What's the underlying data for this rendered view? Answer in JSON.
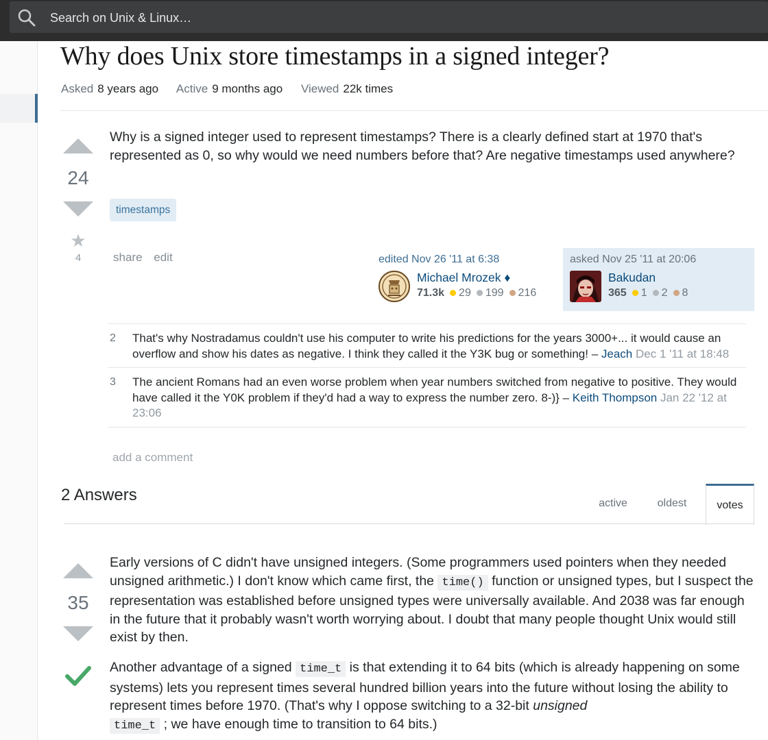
{
  "search": {
    "placeholder": "Search on Unix & Linux…"
  },
  "question": {
    "title": "Why does Unix store timestamps in a signed integer?",
    "meta": [
      {
        "label": "Asked",
        "value": "8 years ago"
      },
      {
        "label": "Active",
        "value": "9 months ago"
      },
      {
        "label": "Viewed",
        "value": "22k times"
      }
    ],
    "votes": "24",
    "favorites": "4",
    "body": "Why is a signed integer used to represent timestamps? There is a clearly defined start at 1970 that's represented as 0, so why would we need numbers before that? Are negative timestamps used anywhere?",
    "tags": [
      "timestamps"
    ],
    "menu": {
      "share": "share",
      "edit": "edit"
    },
    "editor": {
      "action": "edited Nov 26 '11 at 6:38",
      "name": "Michael Mrozek ♦",
      "rep": "71.3k",
      "gold": "29",
      "silver": "199",
      "bronze": "216"
    },
    "owner": {
      "action": "asked Nov 25 '11 at 20:06",
      "name": "Bakudan",
      "rep": "365",
      "gold": "1",
      "silver": "2",
      "bronze": "8"
    },
    "comments": [
      {
        "score": "2",
        "text": "That's why Nostradamus couldn't use his computer to write his predictions for the years 3000+... it would cause an overflow and show his dates as negative. I think they called it the Y3K bug or something!",
        "sep": " – ",
        "user": "Jeach",
        "date": "Dec 1 '11 at 18:48"
      },
      {
        "score": "3",
        "text": "The ancient Romans had an even worse problem when year numbers switched from negative to positive. They would have called it the Y0K problem if they'd had a way to express the number zero. 8-)}",
        "sep": " – ",
        "user": "Keith Thompson",
        "date": "Jan 22 '12 at 23:06"
      }
    ],
    "add_comment": "add a comment"
  },
  "answers": {
    "heading": "2 Answers",
    "tabs": [
      "active",
      "oldest",
      "votes"
    ],
    "selected_tab": "votes",
    "top": {
      "votes": "35",
      "accepted": true,
      "p1": {
        "a": "Early versions of C didn't have unsigned integers. (Some programmers used pointers when they needed unsigned arithmetic.) I don't know which came first, the ",
        "code": "time()",
        "b": " function or unsigned types, but I suspect the representation was established before unsigned types were universally available. And 2038 was far enough in the future that it probably wasn't worth worrying about. I doubt that many people thought Unix would still exist by then."
      },
      "p2": {
        "a": "Another advantage of a signed ",
        "code1": "time_t",
        "b": " is that extending it to 64 bits (which is already happening on some systems) lets you represent times several hundred billion years into the future without losing the ability to represent times before 1970. (That's why I oppose switching to a 32-bit ",
        "em": "unsigned",
        "code2": "time_t",
        "c": " ; we have enough time to transition to 64 bits.)"
      }
    }
  },
  "colors": {
    "accent": "#3d6d93",
    "link": "#0c4b7b",
    "tag_bg": "#e1ecf4",
    "accepted": "#48a868"
  }
}
